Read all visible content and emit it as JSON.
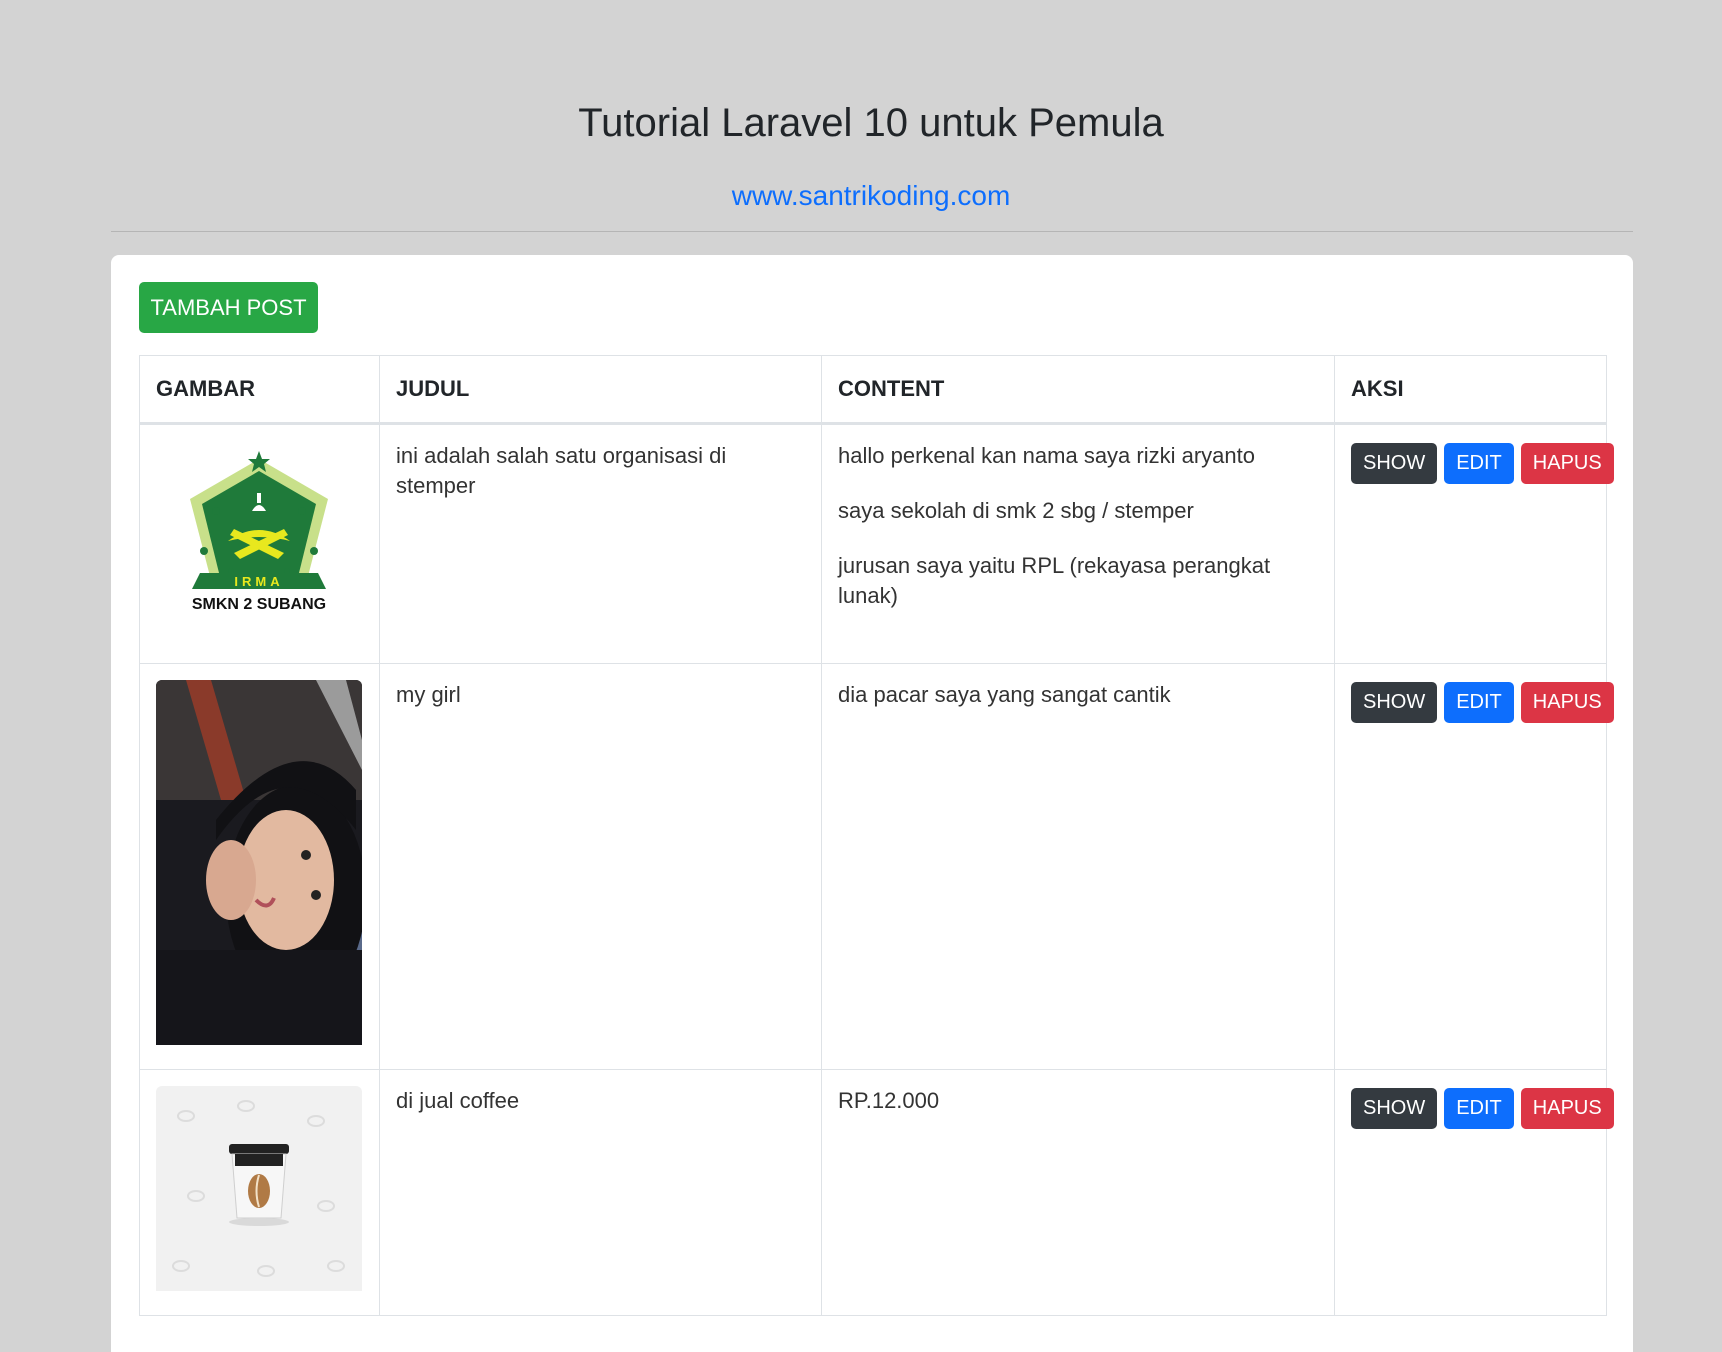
{
  "header": {
    "title": "Tutorial Laravel 10 untuk Pemula",
    "subtitle": "www.santrikoding.com"
  },
  "toolbar": {
    "add_label": "TAMBAH POST"
  },
  "table": {
    "columns": [
      "GAMBAR",
      "JUDUL",
      "CONTENT",
      "AKSI"
    ],
    "rows": [
      {
        "image": "irma-logo",
        "image_caption": "SMKN 2 SUBANG",
        "image_banner": "IRMA",
        "title": "ini adalah salah satu organisasi di stemper",
        "content": [
          "hallo perkenal kan nama saya rizki aryanto",
          "saya sekolah di smk 2 sbg / stemper",
          "jurusan saya yaitu RPL (rekayasa perangkat lunak)"
        ]
      },
      {
        "image": "portrait-photo",
        "title": "my girl",
        "content": [
          "dia pacar saya yang sangat cantik"
        ]
      },
      {
        "image": "coffee-cup-photo",
        "title": "di jual coffee",
        "content": [
          "RP.12.000"
        ]
      }
    ]
  },
  "actions": {
    "show": "SHOW",
    "edit": "EDIT",
    "delete": "HAPUS"
  }
}
